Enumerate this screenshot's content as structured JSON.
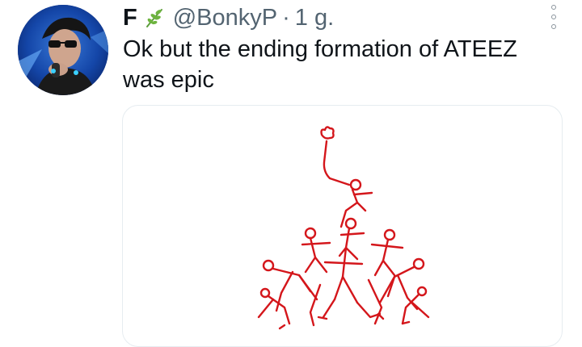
{
  "tweet": {
    "display_name": "F",
    "badge_icon": "leaf-icon",
    "handle": "@BonkyP",
    "separator": "·",
    "timestamp": "1 g.",
    "text_line1": "Ok but the ending formation of ATEEZ",
    "text_line2": "was epic",
    "more_icon": "more-options-icon",
    "colors": {
      "accent_green": "#5c9d3a",
      "sketch_red": "#d4161b",
      "secondary_text": "#536471",
      "avatar_bg": "#0e2f86"
    }
  }
}
